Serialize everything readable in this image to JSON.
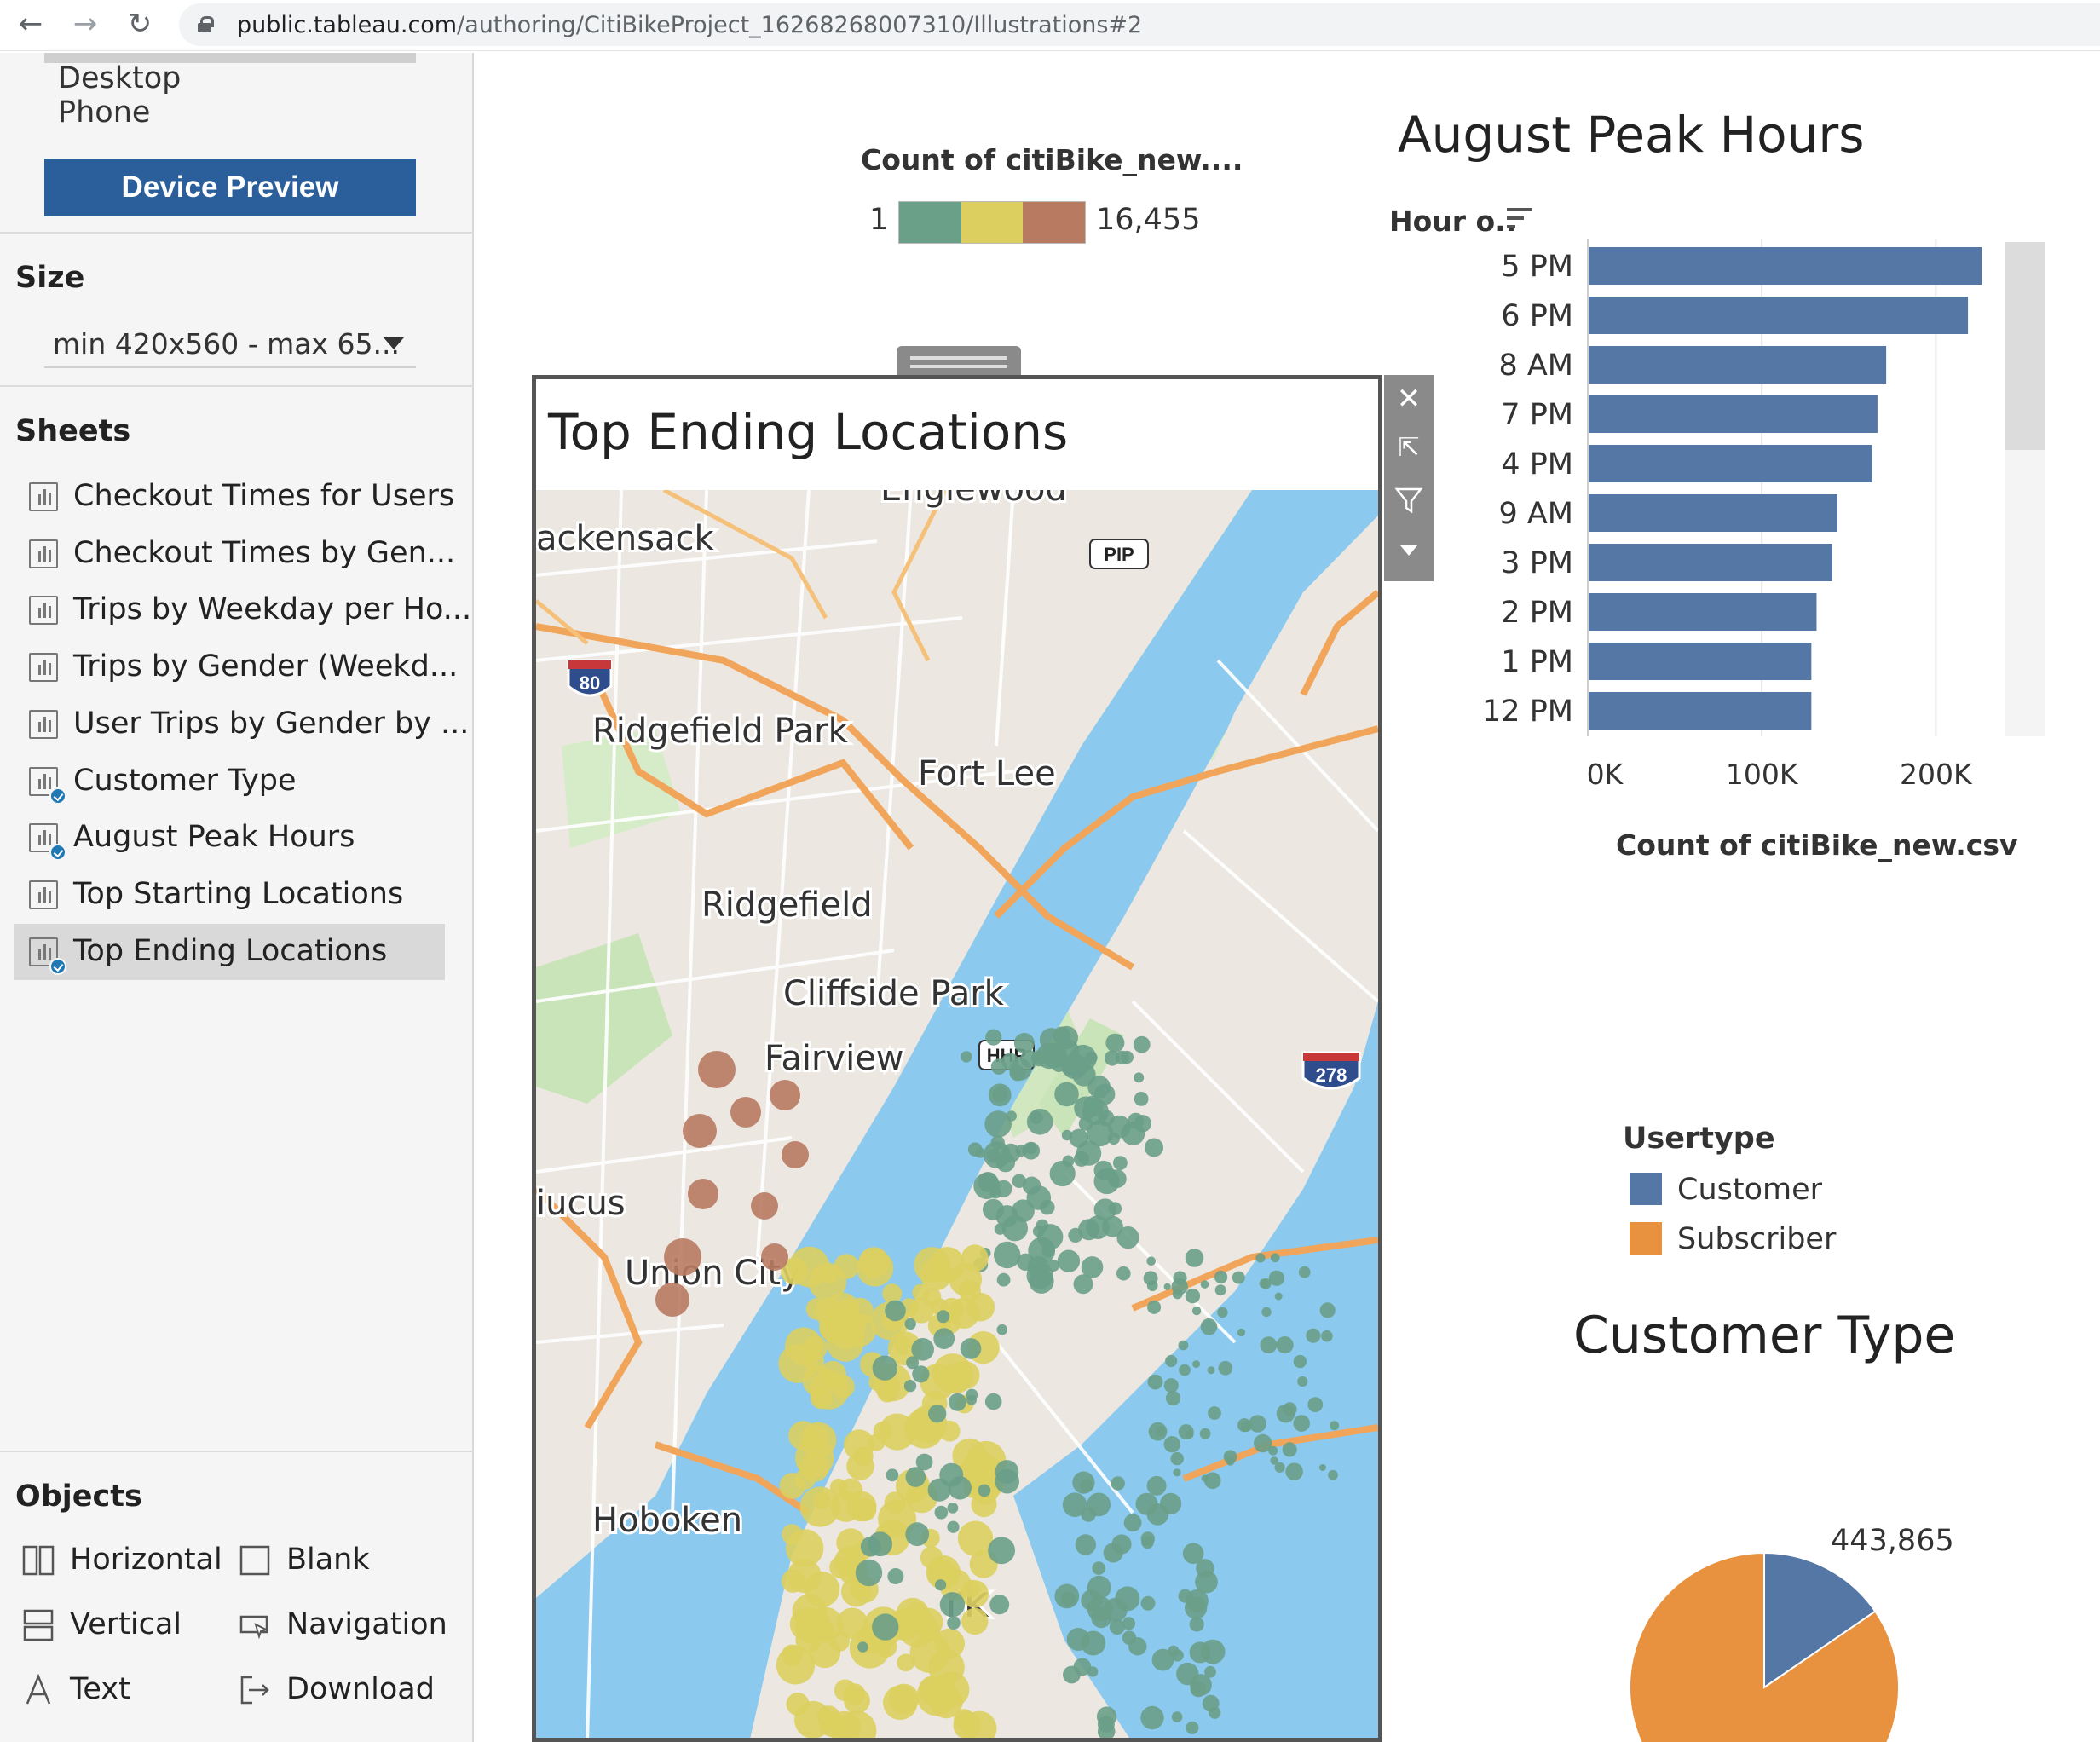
{
  "browser": {
    "url_host": "public.tableau.com",
    "url_path": "/authoring/CitiBikeProject_16268268007310/Illustrations#2"
  },
  "left_panel": {
    "device_options": [
      "Desktop",
      "Phone"
    ],
    "device_preview_label": "Device Preview",
    "size_title": "Size",
    "size_value": "min 420x560 - max 65...",
    "sheets_title": "Sheets",
    "sheets": [
      {
        "label": "Checkout Times for Users",
        "used": false,
        "selected": false
      },
      {
        "label": "Checkout Times by Gen...",
        "used": false,
        "selected": false
      },
      {
        "label": "Trips by Weekday per Ho...",
        "used": false,
        "selected": false
      },
      {
        "label": "Trips by Gender (Weekd...",
        "used": false,
        "selected": false
      },
      {
        "label": "User Trips by Gender by ...",
        "used": false,
        "selected": false
      },
      {
        "label": "Customer Type",
        "used": true,
        "selected": false
      },
      {
        "label": "August Peak Hours",
        "used": true,
        "selected": false
      },
      {
        "label": "Top Starting Locations",
        "used": false,
        "selected": false
      },
      {
        "label": "Top Ending Locations",
        "used": true,
        "selected": true
      }
    ],
    "objects_title": "Objects",
    "objects": [
      {
        "label": "Horizontal",
        "icon": "horizontal-container-icon"
      },
      {
        "label": "Blank",
        "icon": "blank-icon"
      },
      {
        "label": "Vertical",
        "icon": "vertical-container-icon"
      },
      {
        "label": "Navigation",
        "icon": "navigation-icon"
      },
      {
        "label": "Text",
        "icon": "text-icon"
      },
      {
        "label": "Download",
        "icon": "download-icon"
      }
    ]
  },
  "color_legend": {
    "title": "Count of citiBike_new....",
    "min_label": "1",
    "max_label": "16,455",
    "colors": [
      "#6a9f88",
      "#dccf5f",
      "#b97a62"
    ]
  },
  "map": {
    "title": "Top Ending Locations",
    "place_labels": [
      "Englewood",
      "ackensack",
      "Ridgefield Park",
      "Fort Lee",
      "Ridgefield",
      "Cliffside Park",
      "Fairview",
      "iucus",
      "Union City",
      "Hoboken",
      "rk"
    ],
    "highway_labels": [
      "80",
      "278",
      "PIP",
      "HHP"
    ],
    "toolbar_icons": [
      "close-icon",
      "pop-out-icon",
      "filter-icon",
      "more-options-icon"
    ]
  },
  "chart_data": [
    {
      "type": "bar",
      "title": "August Peak Hours",
      "ylabel": "Hour o..",
      "xlabel": "Count of citiBike_new.csv",
      "categories": [
        "5 PM",
        "6 PM",
        "8 AM",
        "7 PM",
        "4 PM",
        "9 AM",
        "3 PM",
        "2 PM",
        "1 PM",
        "12 PM"
      ],
      "values": [
        226000,
        218000,
        171000,
        166000,
        163000,
        143000,
        140000,
        131000,
        128000,
        128000
      ],
      "xlim": [
        0,
        240000
      ],
      "xticks": [
        "0K",
        "100K",
        "200K"
      ],
      "xtick_values": [
        0,
        100000,
        200000
      ],
      "color": "#5577a5",
      "grid": true
    },
    {
      "type": "pie",
      "title": "Customer Type",
      "legend_title": "Usertype",
      "categories": [
        "Customer",
        "Subscriber"
      ],
      "colors": [
        "#5577a5",
        "#e8913e"
      ],
      "values": [
        81000,
        443865
      ],
      "data_labels": [
        "443,865"
      ]
    }
  ]
}
